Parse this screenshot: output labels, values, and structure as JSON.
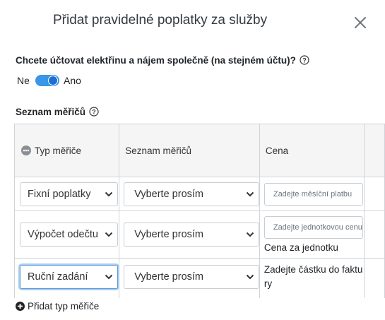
{
  "modal": {
    "title": "Přidat pravidelné poplatky za služby",
    "close_icon": "close-icon"
  },
  "combined_billing": {
    "question": "Chcete účtovat elektřinu a nájem společně (na stejném účtu)?",
    "help_icon": "question-circle-icon",
    "off_label": "Ne",
    "on_label": "Ano",
    "enabled": true
  },
  "meters": {
    "section_title": "Seznam měřičů",
    "help_icon": "question-circle-icon",
    "columns": {
      "type": "Typ měřiče",
      "type_icon": "meter-type-icon",
      "list": "Seznam měřičů",
      "price": "Cena"
    },
    "rows": [
      {
        "type": "Fixní poplatky",
        "list": "Vyberte prosím",
        "price_placeholder": "Zadejte měsíční platbu",
        "note": ""
      },
      {
        "type": "Výpočet odečtu",
        "list": "Vyberte prosím",
        "price_placeholder": "Zadejte jednotkovou cenu",
        "note": "Cena za jednotku"
      },
      {
        "type": "Ruční zadání",
        "list": "Vyberte prosím",
        "price_placeholder": "",
        "note": "Zadejte částku do faktury"
      }
    ],
    "add_label": "Přidat typ měřiče",
    "add_icon": "plus-circle-icon"
  },
  "colors": {
    "accent": "#1d6fd1",
    "toggle_track": "#3a96e6",
    "focus_ring": "#a8ccf0"
  }
}
